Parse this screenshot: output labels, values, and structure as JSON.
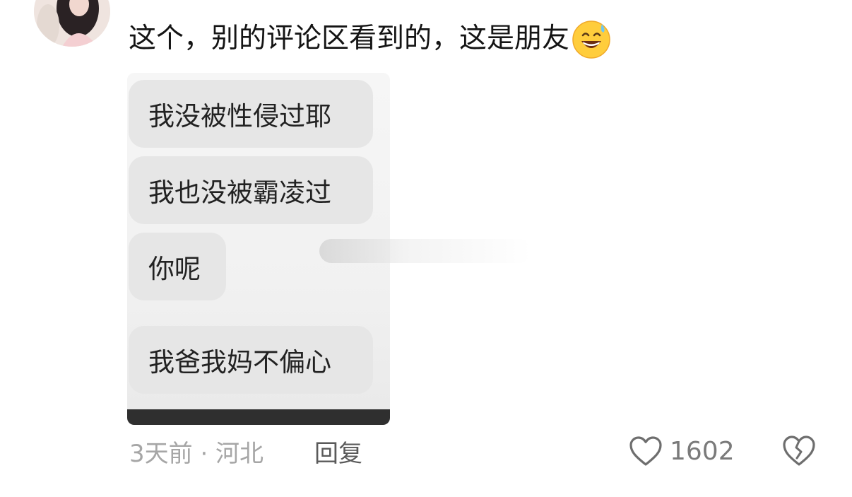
{
  "comment": {
    "username": "",
    "text": "这个，别的评论区看到的，这是朋友",
    "emoji": "grinning-sweat-face-icon"
  },
  "embedded_screenshot": {
    "messages": [
      "我没被性侵过耶",
      "我也没被霸凌过",
      "你呢",
      "我爸我妈不偏心"
    ]
  },
  "footer": {
    "meta": "3天前 · 河北",
    "reply_label": "回复",
    "like_count": "1602"
  },
  "colors": {
    "text": "#141414",
    "meta": "#a6a6a6",
    "bubble": "#e6e6e6"
  }
}
